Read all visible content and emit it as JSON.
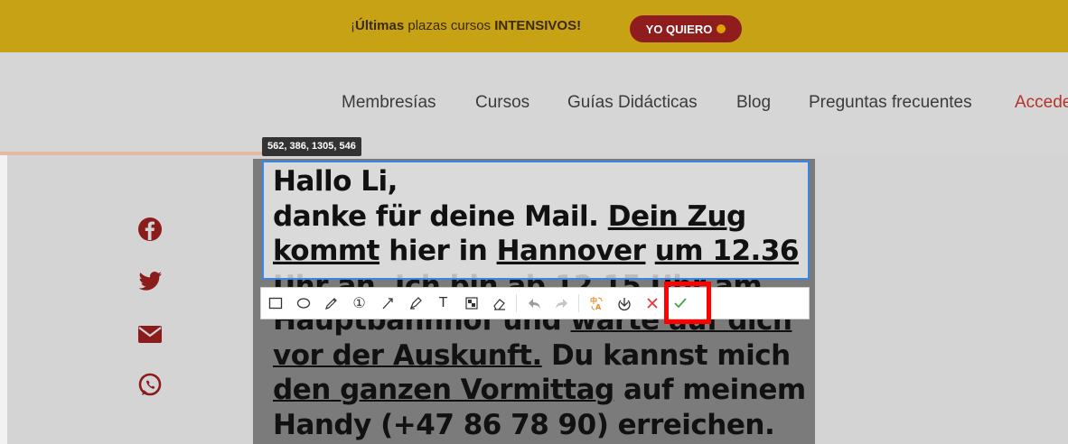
{
  "banner": {
    "prefix": "¡",
    "word1": "Últimas",
    "mid": " plazas cursos ",
    "word2": "INTENSIVOS!",
    "button_label": "YO QUIERO",
    "colors": {
      "background": "#c8a215",
      "button": "#8f1d1d"
    }
  },
  "nav": {
    "items": [
      "Membresías",
      "Cursos",
      "Guías Didácticas",
      "Blog",
      "Preguntas frecuentes",
      "Accede"
    ]
  },
  "social": {
    "icons": [
      "facebook-icon",
      "twitter-icon",
      "email-icon",
      "whatsapp-icon"
    ]
  },
  "selection": {
    "coords": "562, 386, 1305, 546"
  },
  "letter": {
    "line1": "Hallo Li,",
    "line2_plain": "danke für deine Mail. ",
    "line2_u": "Dein Zug",
    "line3_u1": "kommt",
    "line3_plain": " hier in ",
    "line3_u2": "Hannover",
    "line3_sp": " ",
    "line3_u3": "um 12.36",
    "line4": "Uhr an. Ich bin ab 12.15 Uhr am",
    "line5_plain": "Hauptbahnhof und ",
    "line5_u": "warte auf dich",
    "line6_u": "vor der Auskunft.",
    "line6_plain": " Du kannst mich",
    "line7_u": "den ganzen Vormittag",
    "line7_plain": " auf meinem",
    "line8": "Handy (+47 86 78 90) erreichen."
  },
  "toolbar": {
    "tools": [
      "rectangle-tool",
      "ellipse-tool",
      "pen-tool",
      "number-tool",
      "arrow-tool",
      "marker-tool",
      "text-tool",
      "mosaic-tool",
      "eraser-tool",
      "undo",
      "redo",
      "translate",
      "save",
      "cancel",
      "confirm"
    ],
    "text_tool_label": "T",
    "number_tool_label": "①"
  }
}
